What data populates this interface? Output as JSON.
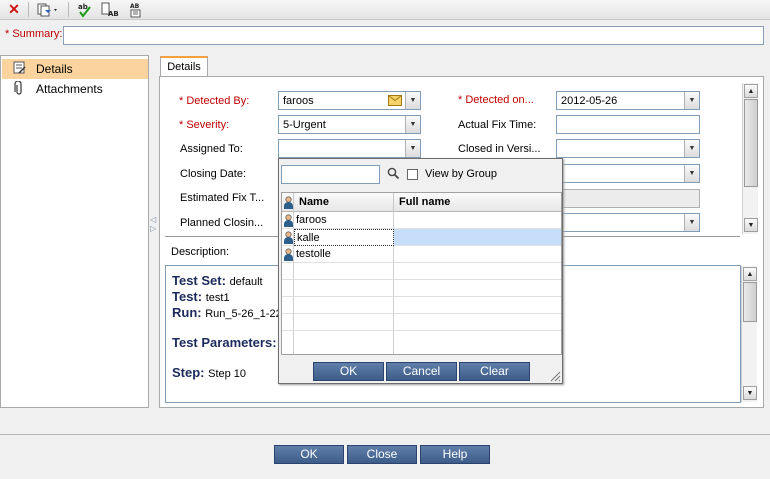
{
  "toolbar": {
    "icons": [
      "delete-icon",
      "copy-dropdown-icon",
      "spell-check-icon",
      "spell-options-icon",
      "thesaurus-icon"
    ]
  },
  "summary": {
    "label": "* Summary:",
    "value": ""
  },
  "sidebar": {
    "items": [
      {
        "label": "Details",
        "icon": "details-icon",
        "selected": true
      },
      {
        "label": "Attachments",
        "icon": "paperclip-icon",
        "selected": false
      }
    ]
  },
  "tab": {
    "label": "Details"
  },
  "fields": {
    "detected_by": {
      "label": "* Detected By:",
      "value": "faroos"
    },
    "detected_on": {
      "label": "* Detected on...",
      "value": "2012-05-26"
    },
    "severity": {
      "label": "* Severity:",
      "value": "5-Urgent"
    },
    "actual_fix_time": {
      "label": "Actual Fix Time:",
      "value": ""
    },
    "assigned_to": {
      "label": "Assigned To:",
      "value": ""
    },
    "closed_in_version": {
      "label": "Closed in Versi...",
      "value": ""
    },
    "closing_date": {
      "label": "Closing Date:",
      "value": ""
    },
    "estimated_fix": {
      "label": "Estimated Fix T..."
    },
    "planned_closing": {
      "label": "Planned Closin..."
    }
  },
  "description": {
    "label": "Description:",
    "lines": [
      {
        "key": "Test Set:",
        "value": "default"
      },
      {
        "key": "Test:",
        "value": "test1"
      },
      {
        "key": "Run:",
        "value": "Run_5-26_1-22"
      },
      {
        "key": "Test Parameters:",
        "value": ""
      },
      {
        "key": "Step:",
        "value": "Step 10"
      }
    ]
  },
  "popup": {
    "search_value": "",
    "view_by_group_label": "View by Group",
    "view_by_group_checked": false,
    "columns": [
      "Name",
      "Full name"
    ],
    "rows": [
      {
        "name": "faroos",
        "full_name": ""
      },
      {
        "name": "kalle",
        "full_name": "",
        "selected": true
      },
      {
        "name": "testolle",
        "full_name": ""
      }
    ],
    "buttons": {
      "ok": "OK",
      "cancel": "Cancel",
      "clear": "Clear"
    }
  },
  "footer": {
    "ok": "OK",
    "close": "Close",
    "help": "Help"
  },
  "colors": {
    "button": "#4a6a96",
    "selected_tab": "#fbd39e",
    "required": "#c00000",
    "grid_selection": "#c6defa"
  }
}
